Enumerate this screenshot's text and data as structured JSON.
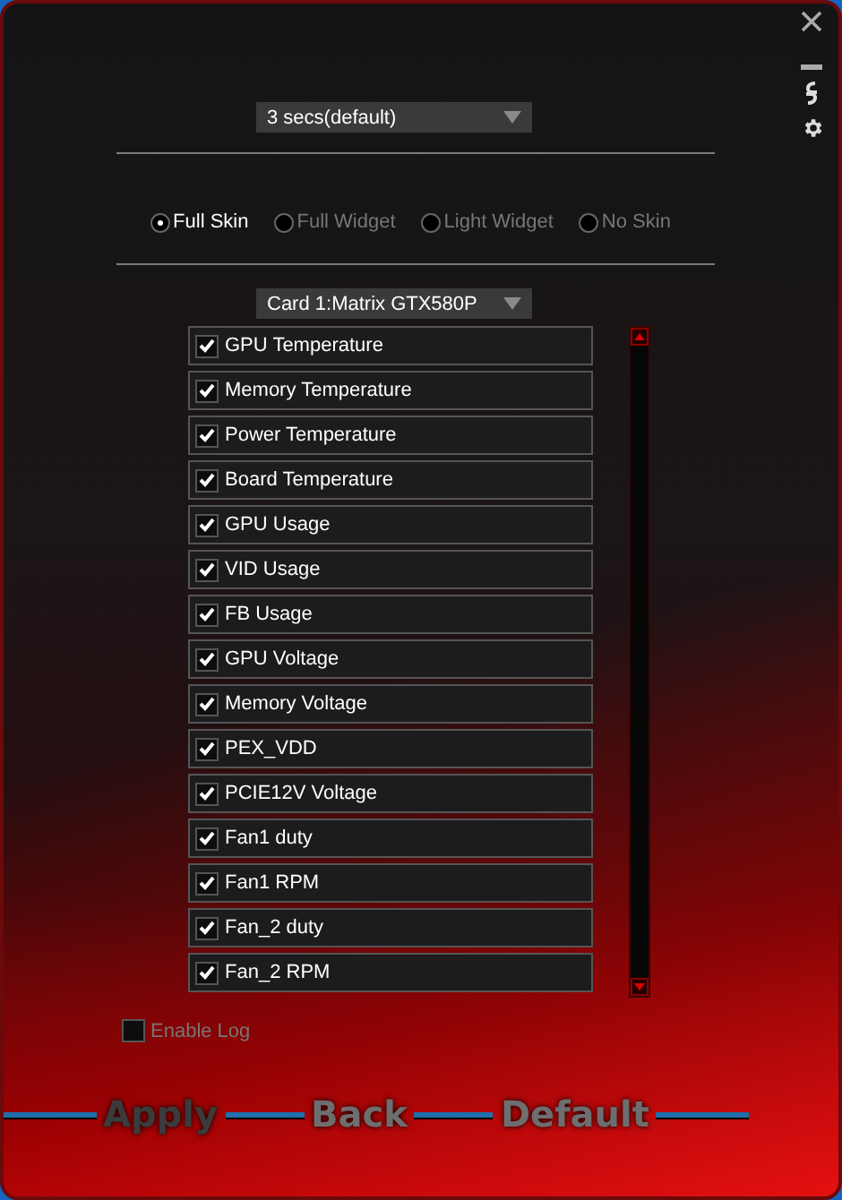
{
  "interval_dropdown": {
    "value": "3 secs(default)"
  },
  "skins": [
    {
      "label": "Full Skin",
      "selected": true
    },
    {
      "label": "Full Widget",
      "selected": false
    },
    {
      "label": "Light Widget",
      "selected": false
    },
    {
      "label": "No Skin",
      "selected": false
    }
  ],
  "card_dropdown": {
    "value": "Card 1:Matrix GTX580P"
  },
  "monitors": [
    {
      "label": "GPU Temperature",
      "checked": true
    },
    {
      "label": "Memory Temperature",
      "checked": true
    },
    {
      "label": "Power Temperature",
      "checked": true
    },
    {
      "label": "Board Temperature",
      "checked": true
    },
    {
      "label": "GPU Usage",
      "checked": true
    },
    {
      "label": "VID Usage",
      "checked": true
    },
    {
      "label": "FB Usage",
      "checked": true
    },
    {
      "label": "GPU Voltage",
      "checked": true
    },
    {
      "label": "Memory Voltage",
      "checked": true
    },
    {
      "label": "PEX_VDD",
      "checked": true
    },
    {
      "label": "PCIE12V Voltage",
      "checked": true
    },
    {
      "label": "Fan1 duty",
      "checked": true
    },
    {
      "label": "Fan1 RPM",
      "checked": true
    },
    {
      "label": "Fan_2 duty",
      "checked": true
    },
    {
      "label": "Fan_2 RPM",
      "checked": true
    }
  ],
  "enable_log": {
    "label": "Enable Log",
    "checked": false
  },
  "buttons": [
    {
      "label": "Apply",
      "disabled": true
    },
    {
      "label": "Back",
      "disabled": false
    },
    {
      "label": "Default",
      "disabled": false
    }
  ]
}
